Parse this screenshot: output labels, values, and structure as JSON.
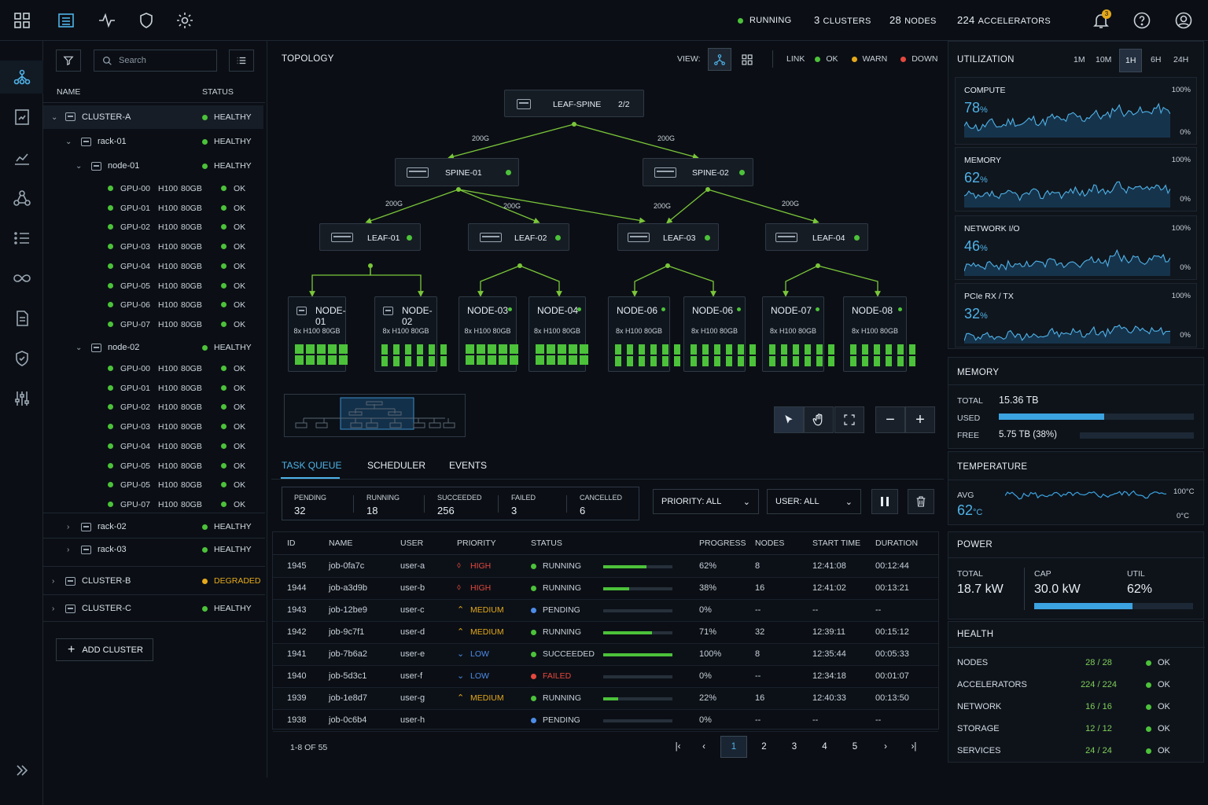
{
  "topbar": {
    "status": "RUNNING",
    "clusters_count": "3",
    "clusters_label": "CLUSTERS",
    "nodes_count": "28",
    "nodes_label": "NODES",
    "accel_count": "224",
    "accel_label": "ACCELERATORS",
    "notification_badge": "3",
    "icons": [
      "grid-icon",
      "list-icon",
      "activity-icon",
      "shield-icon",
      "gear-icon",
      "bell-icon",
      "help-icon",
      "user-icon"
    ]
  },
  "tree": {
    "search_placeholder": "Search",
    "col_name": "NAME",
    "col_status": "STATUS",
    "clusters": [
      {
        "name": "CLUSTER-A",
        "status": "HEALTHY",
        "color": "#4cc23a"
      },
      {
        "name": "CLUSTER-B",
        "status": "DEGRADED",
        "color": "#e5a91a"
      },
      {
        "name": "CLUSTER-C",
        "status": "HEALTHY",
        "color": "#4cc23a"
      }
    ],
    "racks": [
      {
        "name": "rack-01",
        "status": "HEALTHY"
      },
      {
        "name": "rack-02",
        "status": "HEALTHY"
      },
      {
        "name": "rack-03",
        "status": "HEALTHY"
      }
    ],
    "nodes": [
      {
        "name": "node-01",
        "status": "HEALTHY"
      },
      {
        "name": "node-02",
        "status": "HEALTHY"
      }
    ],
    "gpus_node1": [
      {
        "id": "GPU-00",
        "model": "H100",
        "mem": "80GB",
        "status": "OK"
      },
      {
        "id": "GPU-01",
        "model": "H100",
        "mem": "80GB",
        "status": "OK"
      },
      {
        "id": "GPU-02",
        "model": "H100",
        "mem": "80GB",
        "status": "OK"
      },
      {
        "id": "GPU-03",
        "model": "H100",
        "mem": "80GB",
        "status": "OK"
      },
      {
        "id": "GPU-04",
        "model": "H100",
        "mem": "80GB",
        "status": "OK"
      },
      {
        "id": "GPU-05",
        "model": "H100",
        "mem": "80GB",
        "status": "OK"
      },
      {
        "id": "GPU-06",
        "model": "H100",
        "mem": "80GB",
        "status": "OK"
      },
      {
        "id": "GPU-07",
        "model": "H100",
        "mem": "80GB",
        "status": "OK"
      }
    ],
    "gpus_node2": [
      {
        "id": "GPU-00",
        "model": "H100",
        "mem": "80GB",
        "status": "OK"
      },
      {
        "id": "GPU-01",
        "model": "H100",
        "mem": "80GB",
        "status": "OK"
      },
      {
        "id": "GPU-02",
        "model": "H100",
        "mem": "80GB",
        "status": "OK"
      },
      {
        "id": "GPU-03",
        "model": "H100",
        "mem": "80GB",
        "status": "OK"
      },
      {
        "id": "GPU-04",
        "model": "H100",
        "mem": "80GB",
        "status": "OK"
      },
      {
        "id": "GPU-05",
        "model": "H100",
        "mem": "80GB",
        "status": "OK"
      },
      {
        "id": "GPU-05",
        "model": "H100",
        "mem": "80GB",
        "status": "OK"
      },
      {
        "id": "GPU-07",
        "model": "H100",
        "mem": "80GB",
        "status": "OK"
      }
    ],
    "add_cluster": "ADD CLUSTER"
  },
  "topology": {
    "title": "TOPOLOGY",
    "view_label": "VIEW:",
    "link_label": "LINK",
    "ok": "OK",
    "warn": "WARN",
    "down": "DOWN",
    "root": {
      "name": "LEAF-SPINE",
      "count": "2/2"
    },
    "spines": [
      "SPINE-01",
      "SPINE-02"
    ],
    "leaves": [
      "LEAF-01",
      "LEAF-02",
      "LEAF-03",
      "LEAF-04"
    ],
    "link_labels": [
      "200G",
      "200G",
      "200G",
      "200G",
      "200G",
      "200G"
    ],
    "nodes": [
      {
        "name": "NODE-01",
        "spec": "8x H100 80GB"
      },
      {
        "name": "NODE-02",
        "spec": "8x H100 80GB"
      },
      {
        "name": "NODE-03",
        "spec": "8x H100 80GB"
      },
      {
        "name": "NODE-04",
        "spec": "8x H100 80GB"
      },
      {
        "name": "NODE-06",
        "spec": "8x H100 80GB"
      },
      {
        "name": "NODE-06",
        "spec": "8x H100 80GB"
      },
      {
        "name": "NODE-07",
        "spec": "8x H100 80GB"
      },
      {
        "name": "NODE-08",
        "spec": "8x H100 80GB"
      }
    ]
  },
  "tasks": {
    "tabs": [
      "TASK QUEUE",
      "SCHEDULER",
      "EVENTS"
    ],
    "summary": [
      {
        "label": "PENDING",
        "value": "32"
      },
      {
        "label": "RUNNING",
        "value": "18"
      },
      {
        "label": "SUCCEEDED",
        "value": "256"
      },
      {
        "label": "FAILED",
        "value": "3"
      },
      {
        "label": "CANCELLED",
        "value": "6"
      }
    ],
    "priority_filter": "PRIORITY: ALL",
    "user_filter": "USER: ALL",
    "columns": [
      "ID",
      "NAME",
      "USER",
      "PRIORITY",
      "STATUS",
      "PROGRESS",
      "NODES",
      "START TIME",
      "DURATION"
    ],
    "rows": [
      {
        "id": "1945",
        "name": "job-0fa7c",
        "user": "user-a",
        "priority": "HIGH",
        "status": "RUNNING",
        "progress": 0.62,
        "progress_text": "62%",
        "nodes": "8",
        "start": "12:41:08",
        "duration": "00:12:44"
      },
      {
        "id": "1944",
        "name": "job-a3d9b",
        "user": "user-b",
        "priority": "HIGH",
        "status": "RUNNING",
        "progress": 0.38,
        "progress_text": "38%",
        "nodes": "16",
        "start": "12:41:02",
        "duration": "00:13:21"
      },
      {
        "id": "1943",
        "name": "job-12be9",
        "user": "user-c",
        "priority": "MEDIUM",
        "status": "PENDING",
        "progress": 0,
        "progress_text": "0%",
        "nodes": "--",
        "start": "--",
        "duration": "--"
      },
      {
        "id": "1942",
        "name": "job-9c7f1",
        "user": "user-d",
        "priority": "MEDIUM",
        "status": "RUNNING",
        "progress": 0.71,
        "progress_text": "71%",
        "nodes": "32",
        "start": "12:39:11",
        "duration": "00:15:12"
      },
      {
        "id": "1941",
        "name": "job-7b6a2",
        "user": "user-e",
        "priority": "LOW",
        "status": "SUCCEEDED",
        "progress": 1.0,
        "progress_text": "100%",
        "nodes": "8",
        "start": "12:35:44",
        "duration": "00:05:33"
      },
      {
        "id": "1940",
        "name": "job-5d3c1",
        "user": "user-f",
        "priority": "LOW",
        "status": "FAILED",
        "progress": 0,
        "progress_text": "0%",
        "nodes": "--",
        "start": "12:34:18",
        "duration": "00:01:07"
      },
      {
        "id": "1939",
        "name": "job-1e8d7",
        "user": "user-g",
        "priority": "MEDIUM",
        "status": "RUNNING",
        "progress": 0.22,
        "progress_text": "22%",
        "nodes": "16",
        "start": "12:40:33",
        "duration": "00:13:50"
      },
      {
        "id": "1938",
        "name": "job-0c6b4",
        "user": "user-h",
        "priority": "",
        "status": "PENDING",
        "progress": 0,
        "progress_text": "0%",
        "nodes": "--",
        "start": "--",
        "duration": "--"
      }
    ],
    "pagination_info": "1-8 OF 55",
    "pages": [
      "1",
      "2",
      "3",
      "4",
      "5"
    ]
  },
  "utilization": {
    "title": "UTILIZATION",
    "ranges": [
      "1M",
      "10M",
      "1H",
      "6H",
      "24H"
    ],
    "active_range": "1H",
    "metrics": [
      {
        "label": "COMPUTE",
        "value": "78",
        "unit": "%",
        "max": "100%",
        "min": "0%"
      },
      {
        "label": "MEMORY",
        "value": "62",
        "unit": "%",
        "max": "100%",
        "min": "0%"
      },
      {
        "label": "NETWORK I/O",
        "value": "46",
        "unit": "%",
        "max": "100%",
        "min": "0%"
      },
      {
        "label": "PCIe RX / TX",
        "value": "32",
        "unit": "%",
        "max": "100%",
        "min": "0%"
      }
    ]
  },
  "memory": {
    "title": "MEMORY",
    "total_label": "TOTAL",
    "total": "15.36 TB",
    "used_label": "USED",
    "used_fraction": 0.54,
    "free_label": "FREE",
    "free": "5.75 TB (38%)"
  },
  "temperature": {
    "title": "TEMPERATURE",
    "avg_label": "AVG",
    "value": "62",
    "unit": "°C",
    "max": "100°C",
    "min": "0°C"
  },
  "power": {
    "title": "POWER",
    "total_label": "TOTAL",
    "total": "18.7 kW",
    "cap_label": "CAP",
    "cap": "30.0 kW",
    "util_label": "UTIL",
    "util": "62%",
    "util_fraction": 0.62
  },
  "health": {
    "title": "HEALTH",
    "rows": [
      {
        "label": "NODES",
        "value": "28 / 28",
        "status": "OK"
      },
      {
        "label": "ACCELERATORS",
        "value": "224 / 224",
        "status": "OK"
      },
      {
        "label": "NETWORK",
        "value": "16 / 16",
        "status": "OK"
      },
      {
        "label": "STORAGE",
        "value": "12 / 12",
        "status": "OK"
      },
      {
        "label": "SERVICES",
        "value": "24 / 24",
        "status": "OK"
      }
    ]
  },
  "colors": {
    "ok": "#4cc23a",
    "warn": "#e5a91a",
    "down": "#e5483e",
    "accent": "#4fb3e8",
    "pending": "#4d8ce8"
  }
}
